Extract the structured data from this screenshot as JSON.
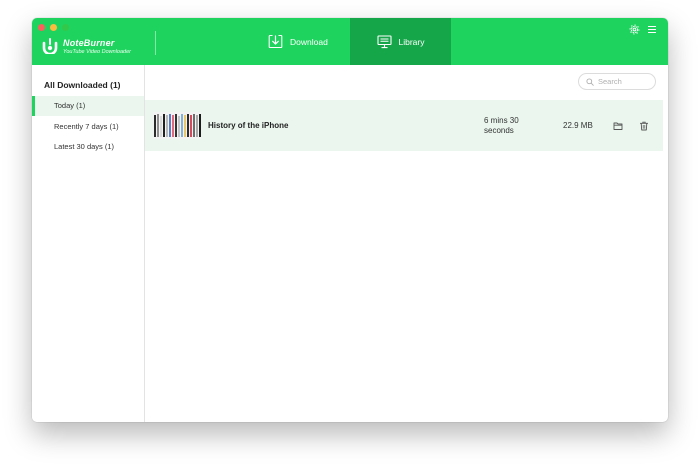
{
  "app": {
    "name": "NoteBurner",
    "subtitle": "YouTube Video Downloader"
  },
  "nav": {
    "download_label": "Download",
    "library_label": "Library"
  },
  "sidebar": {
    "title": "All Downloaded (1)",
    "items": [
      {
        "label": "Today (1)",
        "active": true
      },
      {
        "label": "Recently 7 days (1)",
        "active": false
      },
      {
        "label": "Latest 30 days (1)",
        "active": false
      }
    ]
  },
  "search": {
    "placeholder": "Search",
    "value": ""
  },
  "library": {
    "rows": [
      {
        "title": "History of the iPhone",
        "duration": "6 mins 30 seconds",
        "size": "22.9 MB"
      }
    ]
  },
  "colors": {
    "accent": "#1ed35e",
    "accent_dark": "#16a64a",
    "row_highlight": "#eaf6ee"
  },
  "icons": {
    "logo": "noteburner-logo-icon",
    "download": "download-icon",
    "library": "monitor-icon",
    "settings": "gear-icon",
    "menu": "menu-icon",
    "search": "search-icon",
    "open_folder": "folder-icon",
    "delete": "trash-icon"
  }
}
